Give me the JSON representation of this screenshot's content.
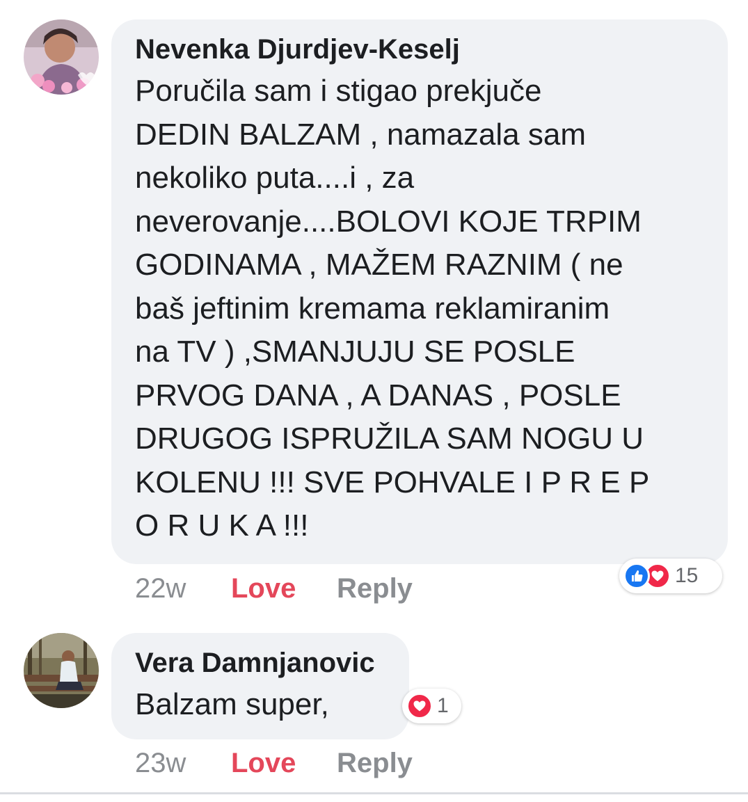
{
  "comments": [
    {
      "author": "Nevenka Djurdjev-Keselj",
      "text": "Poručila sam i stigao prekjuče\nDEDIN BALZAM , namazala sam\nnekoliko puta....i , za\nneverovanje....BOLOVI KOJE TRPIM\nGODINAMA , MAŽEM RAZNIM ( ne\nbaš jeftinim kremama reklamiranim\nna TV ) ,SMANJUJU SE POSLE\nPRVOG DANA , A DANAS , POSLE\nDRUGOG ISPRUŽILA SAM NOGU U\nKOLENU !!! SVE POHVALE I P R E P\nO R U K A !!!",
      "time": "22w",
      "love_label": "Love",
      "reply_label": "Reply",
      "reactions": [
        "like-icon",
        "heart-icon"
      ],
      "reaction_count": "15"
    },
    {
      "author": "Vera Damnjanovic",
      "text": "Balzam super,",
      "time": "23w",
      "love_label": "Love",
      "reply_label": "Reply",
      "reactions": [
        "heart-icon"
      ],
      "reaction_count": "1"
    }
  ],
  "colors": {
    "bubble": "#f0f2f5",
    "love": "#e4475a",
    "meta": "#8a8d91",
    "like": "#1877f2",
    "heart": "#f02849"
  }
}
